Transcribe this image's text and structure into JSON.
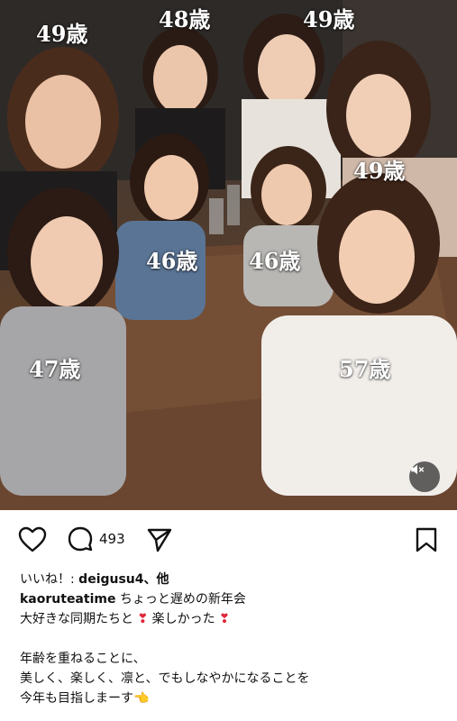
{
  "post": {
    "ages": [
      "49歳",
      "48歳",
      "49歳",
      "49歳",
      "46歳",
      "46歳",
      "47歳",
      "57歳"
    ],
    "comment_count": "493"
  },
  "caption": {
    "likes_prefix": "いいね！: ",
    "likes_user": "deigusu4",
    "likes_suffix": "、他",
    "username": "kaoruteatime",
    "line1_text": " ちょっと遅めの新年会",
    "line2_a": "大好きな同期たちと ",
    "heart_emoji": "❣",
    "line2_b": " 楽しかった ",
    "line3": "年齢を重ねることに、",
    "line4": "美しく、楽しく、凛と、でもしなやかになることを",
    "line5": "今年も目指しまーす",
    "hand_emoji": "👈"
  },
  "icons": {
    "like": "heart-outline-icon",
    "comment": "comment-bubble-icon",
    "share": "send-paper-plane-icon",
    "save": "bookmark-icon",
    "mute": "speaker-muted-icon"
  }
}
